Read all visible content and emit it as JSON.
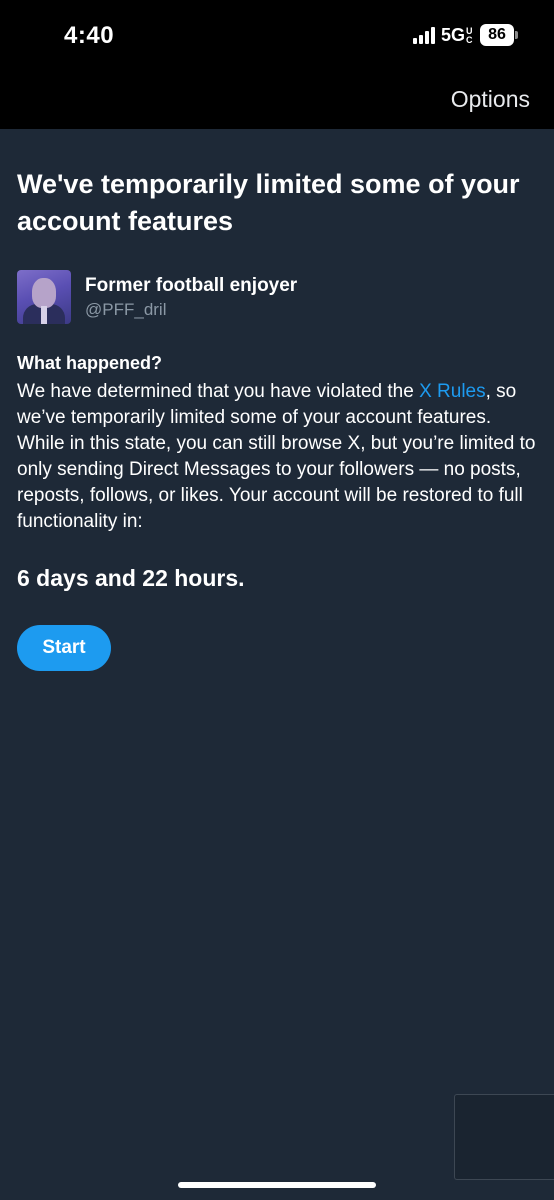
{
  "status_bar": {
    "time": "4:40",
    "network": "5G",
    "network_sub": "UC",
    "battery": "86"
  },
  "header": {
    "options_label": "Options"
  },
  "main": {
    "title": "We've temporarily limited some of your account features",
    "profile": {
      "name": "Former football enjoyer",
      "handle": "@PFF_dril"
    },
    "section_heading": "What happened?",
    "body_before_link": "We have determined that you have violated the ",
    "link_text": "X Rules",
    "body_after_link": ", so we’ve temporarily limited some of your account features. While in this state, you can still browse X, but you’re limited to only sending Direct Messages to your followers — no posts, reposts, follows, or likes. Your account will be restored to full functionality in:",
    "duration": "6 days and 22 hours.",
    "start_label": "Start"
  },
  "colors": {
    "background": "#1e2937",
    "accent": "#1d9bf0",
    "secondary_text": "#8b98a5"
  }
}
